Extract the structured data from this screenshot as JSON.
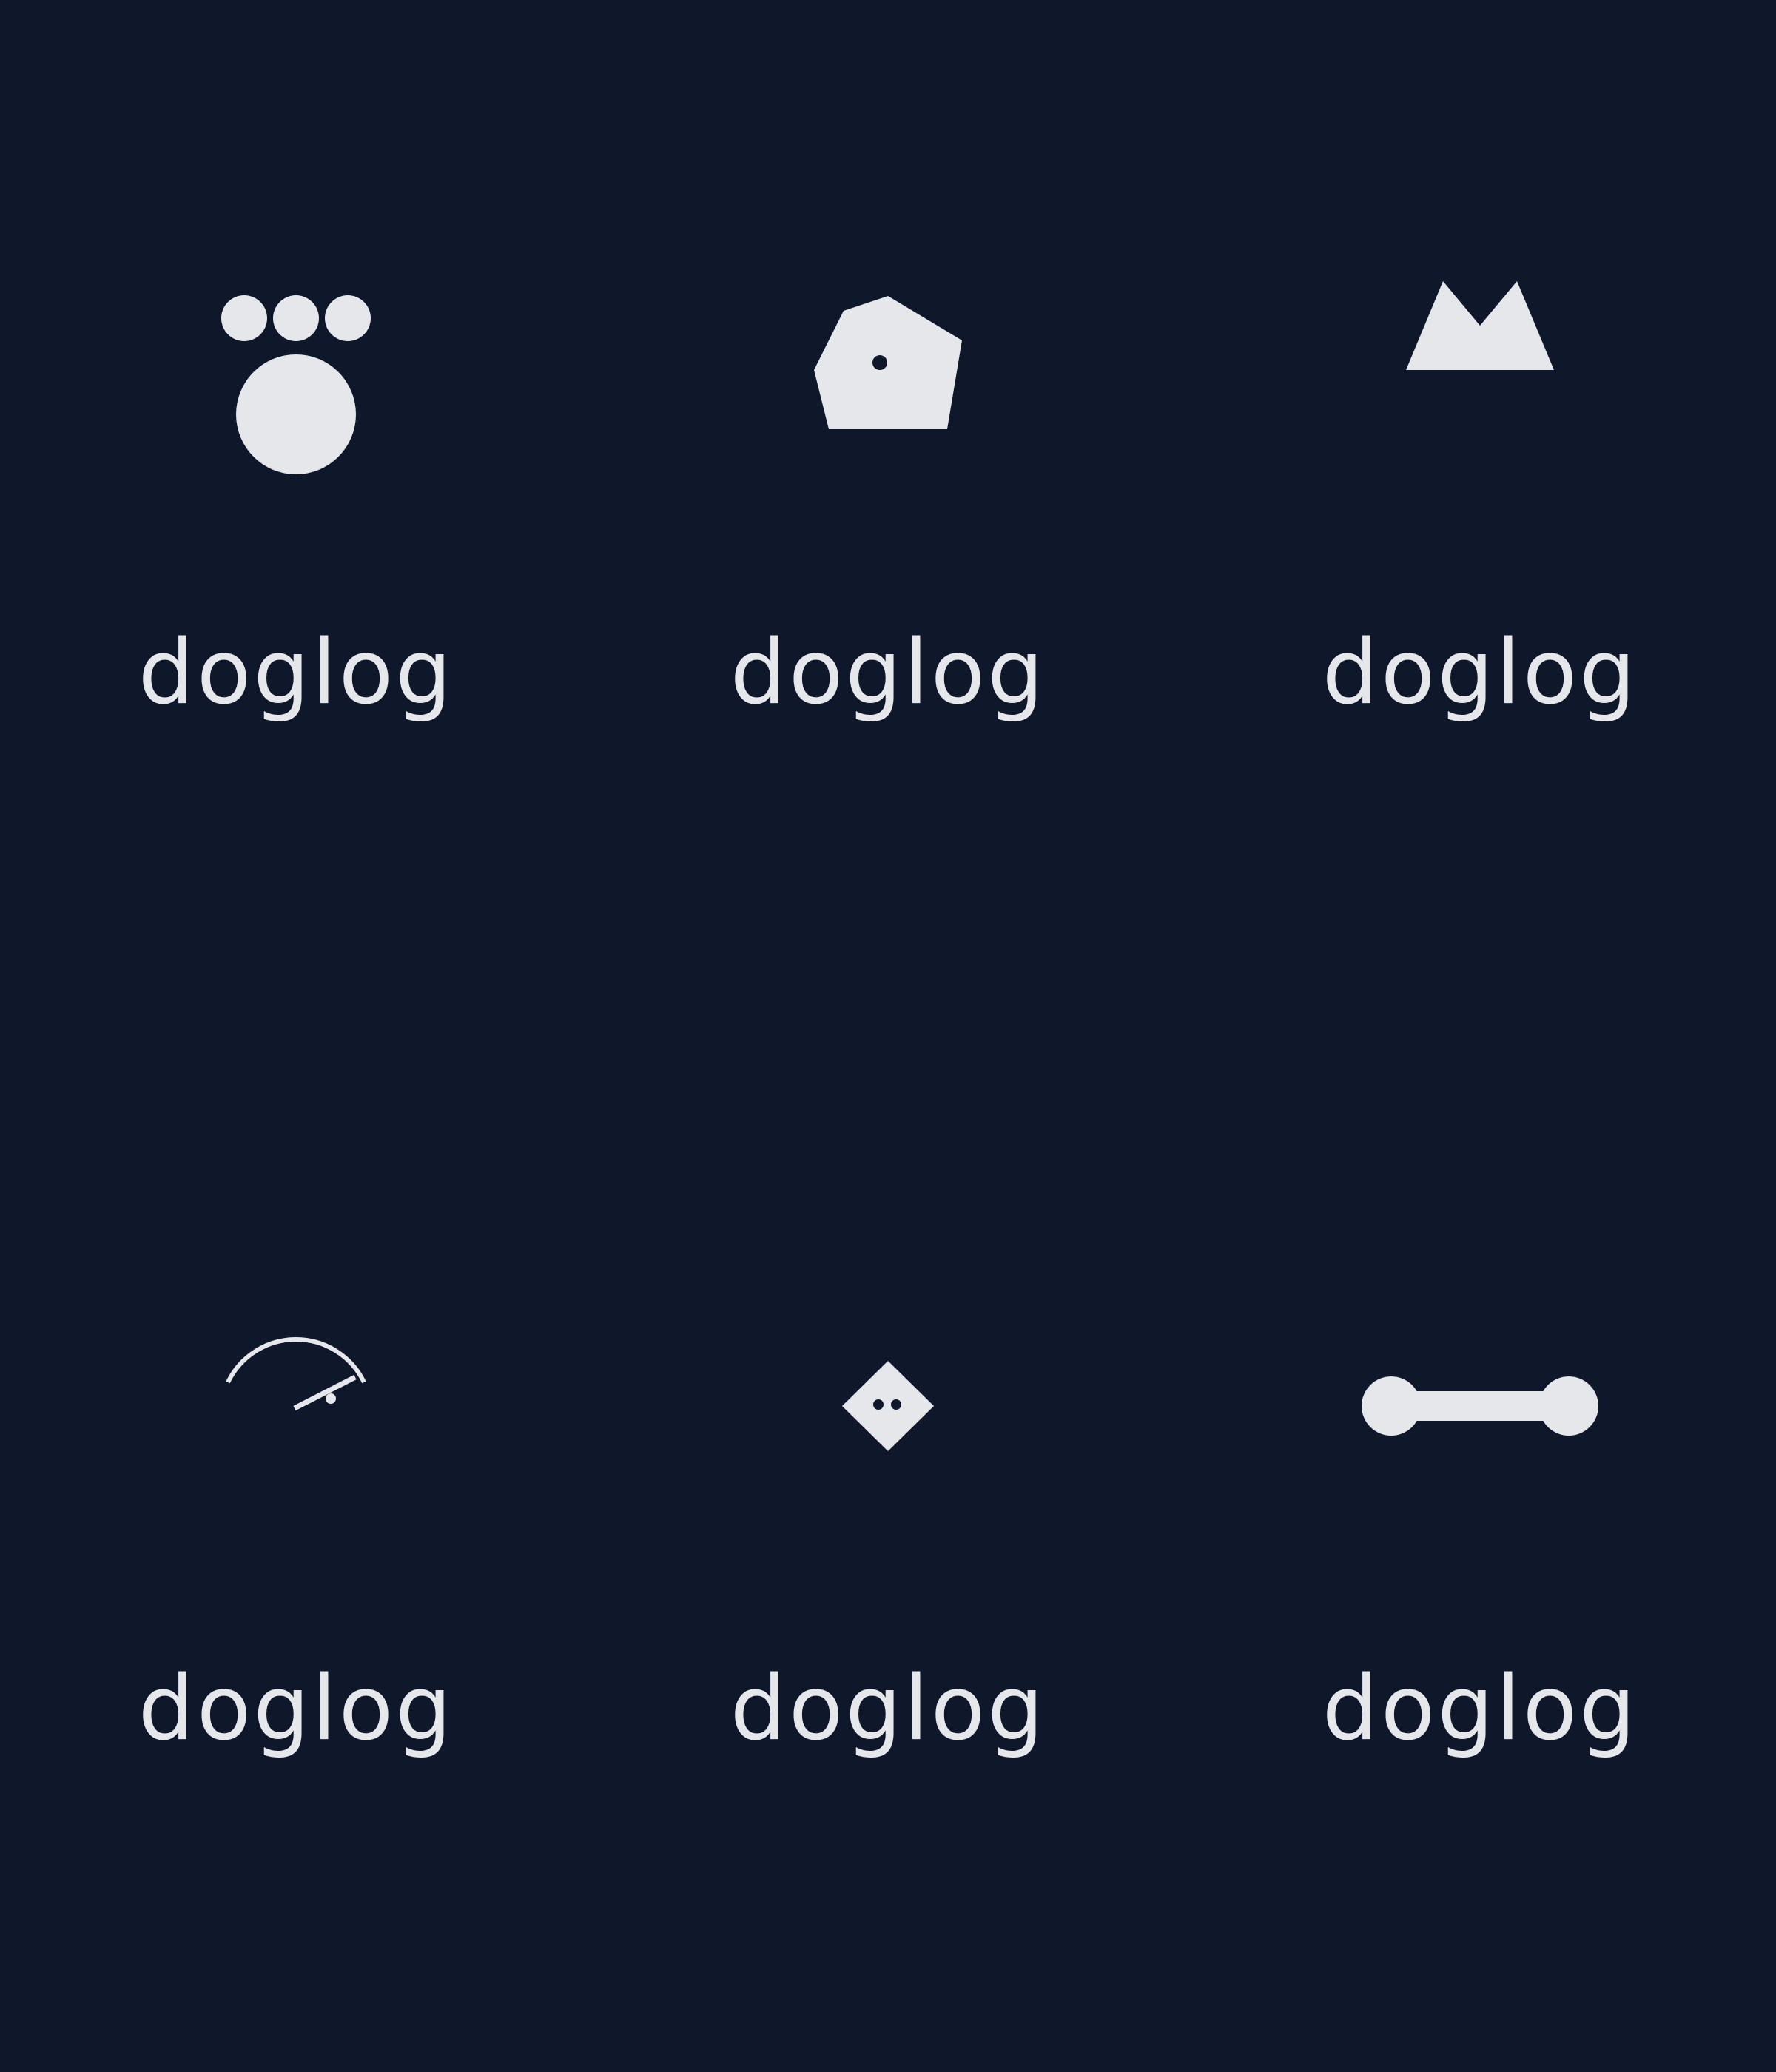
{
  "background_color": "#0f172a",
  "foreground_color": "#e5e7eb",
  "logos": [
    {
      "icon": "paw-print-icon",
      "wordmark": "doglog"
    },
    {
      "icon": "pentagon-head-icon",
      "wordmark": "doglog"
    },
    {
      "icon": "pointed-ears-icon",
      "wordmark": "doglog"
    },
    {
      "icon": "arc-leash-icon",
      "wordmark": "doglog"
    },
    {
      "icon": "diamond-face-icon",
      "wordmark": "doglog"
    },
    {
      "icon": "bone-icon",
      "wordmark": "doglog"
    }
  ]
}
